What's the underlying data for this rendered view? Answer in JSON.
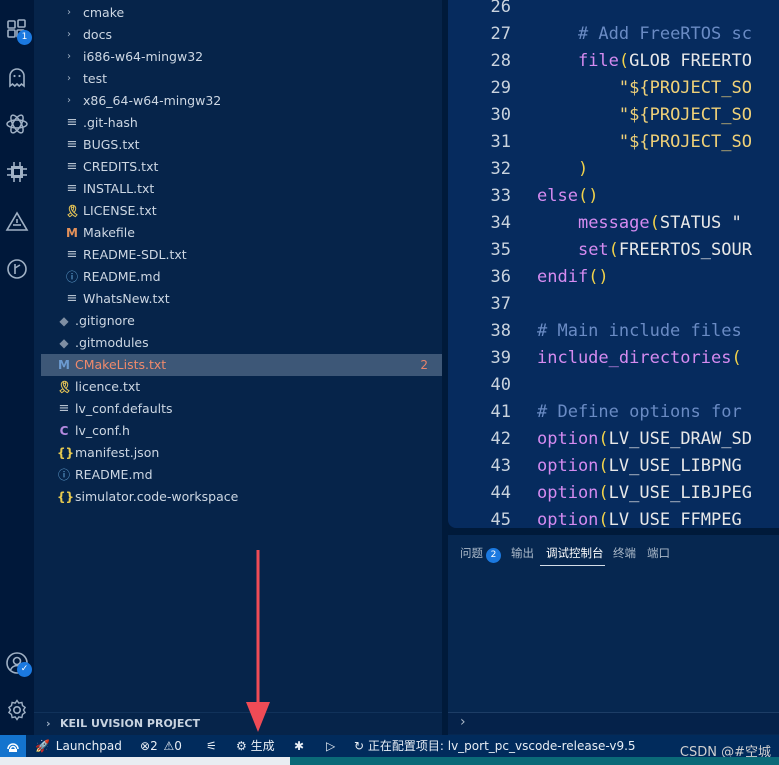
{
  "activity_bar": {
    "items": [
      {
        "icon": "extensions-icon",
        "badge": "1"
      },
      {
        "icon": "ghost-icon"
      },
      {
        "icon": "atom-icon"
      },
      {
        "icon": "chip-icon"
      },
      {
        "icon": "alert-triangle-icon"
      },
      {
        "icon": "git-fork-icon"
      }
    ],
    "accounts_badge_icon": "check-icon",
    "bottom_items": [
      "account-icon",
      "settings-gear-icon"
    ]
  },
  "explorer": {
    "items": [
      {
        "label": "cmake",
        "type": "folder",
        "depth": 1
      },
      {
        "label": "docs",
        "type": "folder",
        "depth": 1
      },
      {
        "label": "i686-w64-mingw32",
        "type": "folder",
        "depth": 1
      },
      {
        "label": "test",
        "type": "folder",
        "depth": 1
      },
      {
        "label": "x86_64-w64-mingw32",
        "type": "folder",
        "depth": 1
      },
      {
        "label": ".git-hash",
        "icon": "lines",
        "depth": 1
      },
      {
        "label": "BUGS.txt",
        "icon": "lines",
        "depth": 1
      },
      {
        "label": "CREDITS.txt",
        "icon": "lines",
        "depth": 1
      },
      {
        "label": "INSTALL.txt",
        "icon": "lines",
        "depth": 1
      },
      {
        "label": "LICENSE.txt",
        "icon": "ribbon",
        "depth": 1
      },
      {
        "label": "Makefile",
        "icon": "m",
        "depth": 1
      },
      {
        "label": "README-SDL.txt",
        "icon": "lines",
        "depth": 1
      },
      {
        "label": "README.md",
        "icon": "info",
        "depth": 1
      },
      {
        "label": "WhatsNew.txt",
        "icon": "lines",
        "depth": 1
      },
      {
        "label": ".gitignore",
        "icon": "git",
        "depth": 0
      },
      {
        "label": ".gitmodules",
        "icon": "git",
        "depth": 0
      },
      {
        "label": "CMakeLists.txt",
        "icon": "m-blue",
        "depth": 0,
        "selected": true,
        "problems": "2"
      },
      {
        "label": "licence.txt",
        "icon": "ribbon",
        "depth": 0
      },
      {
        "label": "lv_conf.defaults",
        "icon": "lines",
        "depth": 0
      },
      {
        "label": "lv_conf.h",
        "icon": "c",
        "depth": 0
      },
      {
        "label": "manifest.json",
        "icon": "json",
        "depth": 0
      },
      {
        "label": "README.md",
        "icon": "info",
        "depth": 0
      },
      {
        "label": "simulator.code-workspace",
        "icon": "json",
        "depth": 0
      }
    ],
    "keil_section": "KEIL UVISION PROJECT"
  },
  "editor": {
    "lines": [
      {
        "n": "26",
        "indent": "",
        "tokens": []
      },
      {
        "n": "27",
        "indent": "    ",
        "tokens": [
          [
            "cm",
            "# Add FreeRTOS sc"
          ]
        ]
      },
      {
        "n": "28",
        "indent": "    ",
        "tokens": [
          [
            "kw",
            "file"
          ],
          [
            "pn",
            "("
          ],
          [
            "tx",
            "GLOB FREERTO"
          ]
        ]
      },
      {
        "n": "29",
        "indent": "        ",
        "tokens": [
          [
            "st",
            "\"${PROJECT_SO"
          ]
        ]
      },
      {
        "n": "30",
        "indent": "        ",
        "tokens": [
          [
            "st",
            "\"${PROJECT_SO"
          ]
        ]
      },
      {
        "n": "31",
        "indent": "        ",
        "tokens": [
          [
            "st",
            "\"${PROJECT_SO"
          ]
        ]
      },
      {
        "n": "32",
        "indent": "    ",
        "tokens": [
          [
            "pn",
            ")"
          ]
        ]
      },
      {
        "n": "33",
        "indent": "",
        "tokens": [
          [
            "kw",
            "else"
          ],
          [
            "pn",
            "()"
          ]
        ]
      },
      {
        "n": "34",
        "indent": "    ",
        "tokens": [
          [
            "kw",
            "message"
          ],
          [
            "pn",
            "("
          ],
          [
            "tx",
            "STATUS \""
          ]
        ]
      },
      {
        "n": "35",
        "indent": "    ",
        "tokens": [
          [
            "kw",
            "set"
          ],
          [
            "pn",
            "("
          ],
          [
            "tx",
            "FREERTOS_SOUR"
          ]
        ]
      },
      {
        "n": "36",
        "indent": "",
        "tokens": [
          [
            "kw",
            "endif"
          ],
          [
            "pn",
            "()"
          ]
        ]
      },
      {
        "n": "37",
        "indent": "",
        "tokens": []
      },
      {
        "n": "38",
        "indent": "",
        "tokens": [
          [
            "cm",
            "# Main include files"
          ]
        ]
      },
      {
        "n": "39",
        "indent": "",
        "tokens": [
          [
            "kw",
            "include_directories"
          ],
          [
            "pn",
            "("
          ]
        ]
      },
      {
        "n": "40",
        "indent": "",
        "tokens": []
      },
      {
        "n": "41",
        "indent": "",
        "tokens": [
          [
            "cm",
            "# Define options for"
          ]
        ]
      },
      {
        "n": "42",
        "indent": "",
        "tokens": [
          [
            "kw",
            "option"
          ],
          [
            "pn",
            "("
          ],
          [
            "tx",
            "LV_USE_DRAW_SD"
          ]
        ]
      },
      {
        "n": "43",
        "indent": "",
        "tokens": [
          [
            "kw",
            "option"
          ],
          [
            "pn",
            "("
          ],
          [
            "tx",
            "LV_USE_LIBPNG"
          ]
        ]
      },
      {
        "n": "44",
        "indent": "",
        "tokens": [
          [
            "kw",
            "option"
          ],
          [
            "pn",
            "("
          ],
          [
            "tx",
            "LV_USE_LIBJPEG"
          ]
        ]
      },
      {
        "n": "45",
        "indent": "",
        "tokens": [
          [
            "kw",
            "option"
          ],
          [
            "pn",
            "("
          ],
          [
            "tx",
            "LV_USE_FFMPEG"
          ]
        ]
      }
    ]
  },
  "panel": {
    "tabs": [
      {
        "label": "问题",
        "badge": "2"
      },
      {
        "label": "输出"
      },
      {
        "label": "调试控制台",
        "active": true
      },
      {
        "label": "终端"
      },
      {
        "label": "端口"
      }
    ],
    "input_prompt": "›"
  },
  "statusbar": {
    "launchpad": "Launchpad",
    "errors": "2",
    "warnings": "0",
    "build": "生成",
    "configuring": "正在配置项目: lv_port_pc_vscode-release-v9.5"
  },
  "watermark": "CSDN @#空城",
  "colors": {
    "accent": "#1b79e0",
    "annotation_arrow": "#ef4b56",
    "selected_row": "#3d5777"
  }
}
